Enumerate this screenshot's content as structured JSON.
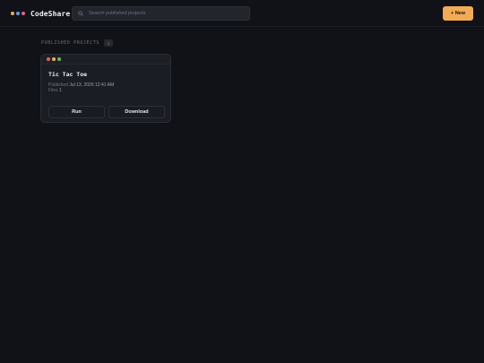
{
  "header": {
    "brand": "CodeShare",
    "brand_dot_colors": [
      "#f2ab55",
      "#5b9cf0",
      "#e2667a"
    ],
    "search": {
      "placeholder": "Search published projects",
      "value": ""
    },
    "new_button_label": "+ New",
    "accent_color": "#f2ab55"
  },
  "section": {
    "title": "PUBLISHED PROJECTS",
    "count": "1"
  },
  "projects": [
    {
      "window_dot_colors": [
        "#e0605a",
        "#e2b04a",
        "#5fb865"
      ],
      "title": "Tic Tac Toe",
      "published_label": "Published",
      "published_date": "Jul 13, 2026 12:41 AM",
      "files_label": "Files",
      "files_count": "1",
      "run_label": "Run",
      "download_label": "Download"
    }
  ]
}
